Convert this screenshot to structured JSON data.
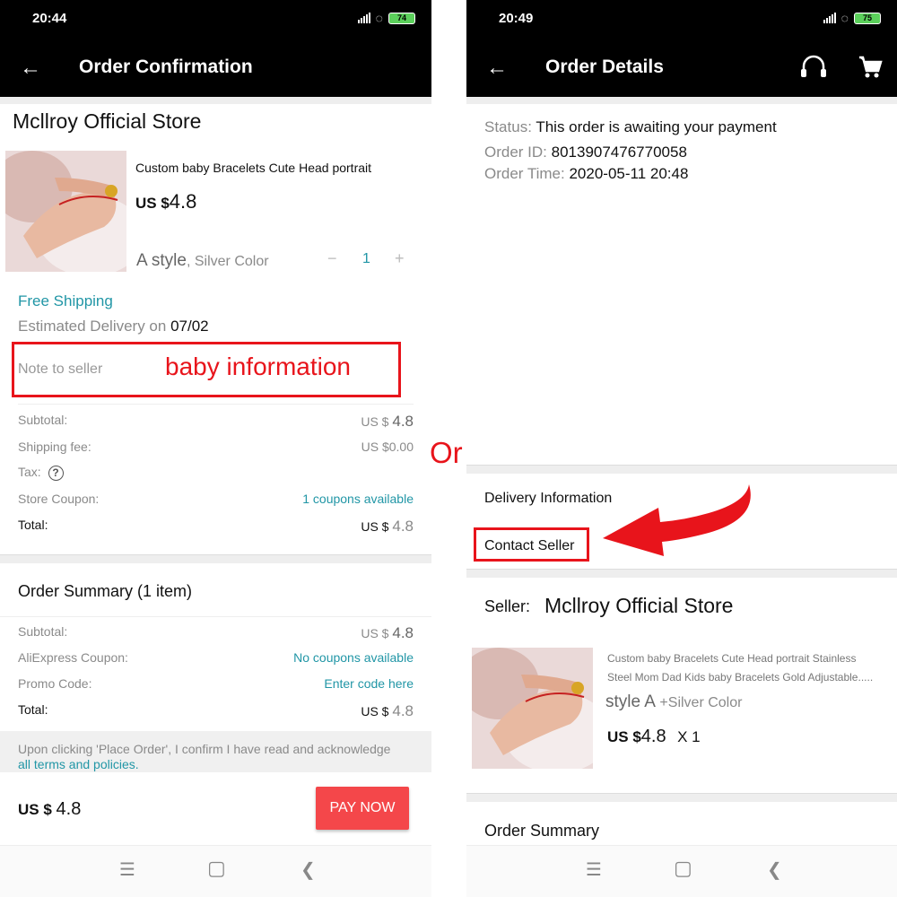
{
  "left": {
    "status": {
      "time": "20:44",
      "battery": "74"
    },
    "appbar": {
      "back_icon": "arrow-left-icon",
      "title": "Order Confirmation"
    },
    "store_name": "Mcllroy Official Store",
    "product": {
      "title": "Custom baby Bracelets Cute Head portrait",
      "price_prefix": "US $",
      "price": "4.8",
      "style": "A style",
      "color": ", Silver Color",
      "minus": "−",
      "quantity": "1",
      "plus": "+"
    },
    "shipping": {
      "free_label": "Free Shipping",
      "estimated_label": "Estimated Delivery on ",
      "estimated_date": "07/02"
    },
    "note": {
      "placeholder": "Note to seller",
      "annotation": "baby information"
    },
    "costs": {
      "subtotal_label": "Subtotal:",
      "subtotal_prefix": "US $ ",
      "subtotal_value": "4.8",
      "shipping_label": "Shipping fee:",
      "shipping_value": "US $0.00",
      "tax_label": "Tax:",
      "tax_icon": "?",
      "coupon_label": "Store Coupon:",
      "coupon_value": "1 coupons available",
      "total_label": "Total:",
      "total_prefix": "US $ ",
      "total_value": "4.8"
    },
    "summary": {
      "title": "Order Summary (1 item)",
      "subtotal_label": "Subtotal:",
      "subtotal_prefix": "US $ ",
      "subtotal_value": "4.8",
      "ali_coupon_label": "AliExpress Coupon:",
      "ali_coupon_value": "No coupons available",
      "promo_label": "Promo Code:",
      "promo_value": "Enter code here",
      "total_label": "Total:",
      "total_prefix": "US $ ",
      "total_value": "4.8"
    },
    "terms": {
      "text": "Upon clicking 'Place Order', I confirm I have read and acknowledge",
      "link": "all terms and policies."
    },
    "footer": {
      "price_prefix": "US $ ",
      "price": "4.8",
      "pay_button": "PAY NOW"
    }
  },
  "or_label": "Or",
  "right": {
    "status": {
      "time": "20:49",
      "battery": "75"
    },
    "appbar": {
      "back_icon": "arrow-left-icon",
      "title": "Order Details",
      "support_icon": "headset-icon",
      "cart_icon": "cart-icon"
    },
    "order": {
      "status_label": "Status: ",
      "status_value": "This order is awaiting your payment",
      "id_label": "Order ID: ",
      "id_value": "8013907476770058",
      "time_label": "Order Time: ",
      "time_value": "2020-05-11 20:48"
    },
    "delivery_info": "Delivery Information",
    "contact_seller": "Contact Seller",
    "seller": {
      "label": "Seller:",
      "name": "Mcllroy Official Store"
    },
    "product": {
      "title_line1": "Custom baby Bracelets Cute Head portrait Stainless",
      "title_line2": "Steel Mom Dad Kids baby Bracelets Gold Adjustable.....",
      "style": "style A",
      "color": " +Silver Color",
      "price_prefix": "US $",
      "price": "4.8",
      "quantity": "X 1"
    },
    "order_summary": "Order Summary"
  },
  "nav_icons": [
    "menu-icon",
    "home-icon",
    "back-icon"
  ],
  "colors": {
    "annotation_red": "#e8141b",
    "link_blue": "#2196a6",
    "pay_button": "#f4474a"
  }
}
